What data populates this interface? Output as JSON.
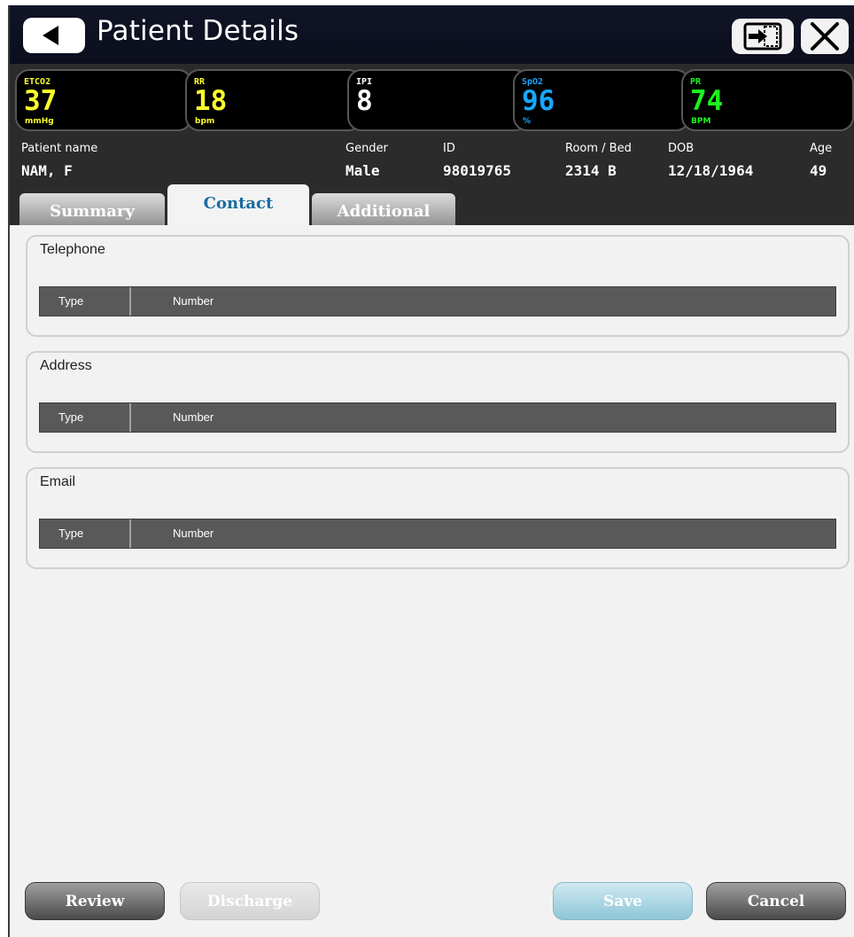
{
  "window": {
    "title": "Patient Details",
    "icons": {
      "back": "back-arrow-icon",
      "transfer": "transfer-icon",
      "close": "close-icon"
    }
  },
  "vitals": [
    {
      "label": "ETCO2",
      "value": "37",
      "unit": "mmHg",
      "color": "#ffff2a"
    },
    {
      "label": "RR",
      "value": "18",
      "unit": "bpm",
      "color": "#ffff2a"
    },
    {
      "label": "IPI",
      "value": "8",
      "unit": "",
      "color": "#ffffff"
    },
    {
      "label": "SpO2",
      "value": "96",
      "unit": "%",
      "color": "#17a7ff"
    },
    {
      "label": "PR",
      "value": "74",
      "unit": "BPM",
      "color": "#1cf51c"
    }
  ],
  "patient": {
    "name_label": "Patient name",
    "name": "NAM, F",
    "gender_label": "Gender",
    "gender": "Male",
    "id_label": "ID",
    "id": "98019765",
    "room_label": "Room / Bed",
    "room": "2314 B",
    "dob_label": "DOB",
    "dob": "12/18/1964",
    "age_label": "Age",
    "age": "49"
  },
  "tabs": [
    {
      "label": "Summary",
      "active": false
    },
    {
      "label": "Contact",
      "active": true
    },
    {
      "label": "Additional",
      "active": false
    }
  ],
  "contact": {
    "telephone": {
      "title": "Telephone",
      "col_type": "Type",
      "col_number": "Number"
    },
    "address": {
      "title": "Address",
      "col_type": "Type",
      "col_number": "Number"
    },
    "email": {
      "title": "Email",
      "col_type": "Type",
      "col_number": "Number"
    }
  },
  "buttons": {
    "review": "Review",
    "discharge": "Discharge",
    "save": "Save",
    "cancel": "Cancel"
  }
}
